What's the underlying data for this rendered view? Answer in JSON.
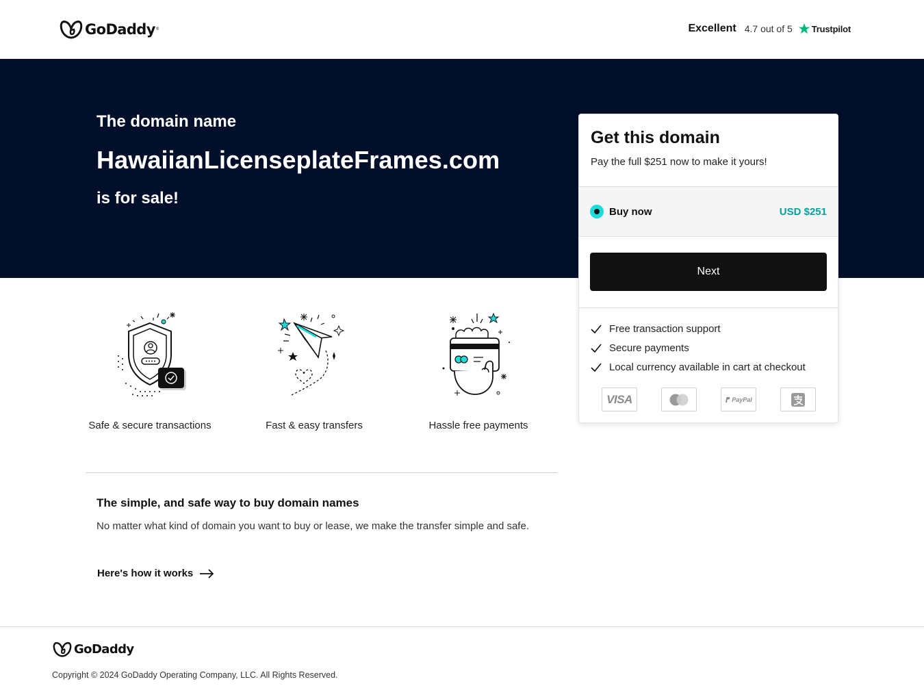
{
  "header": {
    "logo_text": "GoDaddy",
    "rating_word": "Excellent",
    "rating_score": "4.7 out of 5",
    "rating_brand": "Trustpilot"
  },
  "hero": {
    "line1": "The domain name",
    "domain": "HawaiianLicenseplateFrames.com",
    "line3": "is for sale!"
  },
  "card": {
    "title": "Get this domain",
    "subtitle": "Pay the full $251 now to make it yours!",
    "option_label": "Buy now",
    "option_price": "USD $251",
    "next_label": "Next",
    "features": [
      "Free transaction support",
      "Secure payments",
      "Local currency available in cart at checkout"
    ],
    "payment_methods": [
      "VISA",
      "mastercard",
      "PayPal",
      "alipay"
    ]
  },
  "features": [
    {
      "label": "Safe & secure transactions",
      "icon": "shield-icon"
    },
    {
      "label": "Fast & easy transfers",
      "icon": "paper-plane-icon"
    },
    {
      "label": "Hassle free payments",
      "icon": "card-hand-icon"
    }
  ],
  "info": {
    "title": "The simple, and safe way to buy domain names",
    "body": "No matter what kind of domain you want to buy or lease, we make the transfer simple and safe.",
    "link": "Here's how it works"
  },
  "footer": {
    "logo_text": "GoDaddy",
    "copyright": "Copyright © 2024 GoDaddy Operating Company, LLC. All Rights Reserved."
  },
  "colors": {
    "hero_bg": "#020f2a",
    "accent_teal": "#1bdbdb",
    "price_teal": "#0a9f9b",
    "trustpilot_green": "#00b67a",
    "button_bg": "#111111"
  }
}
